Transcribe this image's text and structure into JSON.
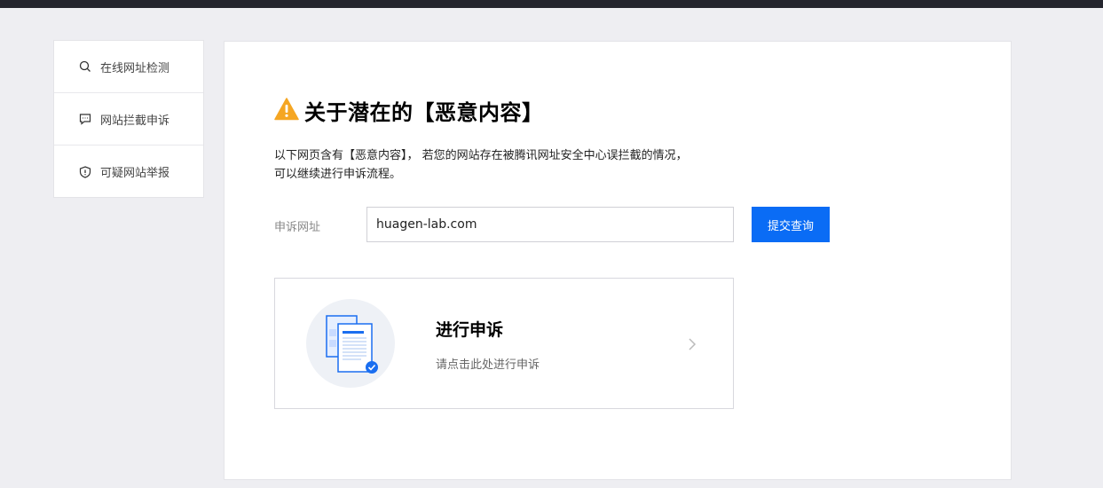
{
  "sidebar": {
    "items": [
      {
        "label": "在线网址检测",
        "icon": "search-icon"
      },
      {
        "label": "网站拦截申诉",
        "icon": "chat-icon"
      },
      {
        "label": "可疑网站举报",
        "icon": "shield-icon"
      }
    ]
  },
  "main": {
    "title": "关于潜在的【恶意内容】",
    "desc_line1": "以下网页含有【恶意内容】， 若您的网站存在被腾讯网址安全中心误拦截的情况，",
    "desc_line2": "可以继续进行申诉流程。",
    "form": {
      "label": "申诉网址",
      "url_value": "huagen-lab.com",
      "submit_label": "提交查询"
    },
    "appeal_card": {
      "title": "进行申诉",
      "subtitle": "请点击此处进行申诉"
    }
  },
  "colors": {
    "accent": "#0a6cf5",
    "warning": "#f5a623",
    "background": "#eeeef2",
    "topbar": "#24252e"
  }
}
